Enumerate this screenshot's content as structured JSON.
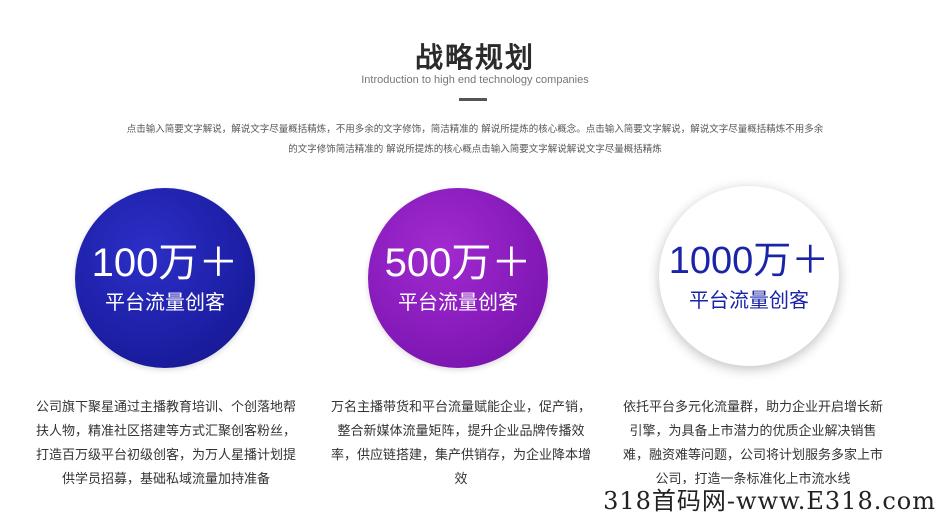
{
  "header": {
    "title": "战略规划",
    "subtitle": "Introduction to high end technology companies",
    "description": "点击输入简要文字解说，解说文字尽量概括精炼，不用多余的文字修饰，简洁精准的 解说所提炼的核心概念。点击输入简要文字解说，解说文字尽量概括精炼不用多余的文字修饰简洁精准的 解说所提炼的核心概点击输入简要文字解说解说文字尽量概括精炼"
  },
  "stats": [
    {
      "value": "100万＋",
      "label": "平台流量创客",
      "text": "公司旗下聚星通过主播教育培训、个创落地帮扶人物，精准社区搭建等方式汇聚创客粉丝，打造百万级平台初级创客，为万人星播计划提供学员招募，基础私域流量加持准备"
    },
    {
      "value": "500万＋",
      "label": "平台流量创客",
      "text": "万名主播带货和平台流量赋能企业，促产销，整合新媒体流量矩阵，提升企业品牌传播效率，供应链搭建，集产供销存，为企业降本增效"
    },
    {
      "value": "1000万＋",
      "label": "平台流量创客",
      "text": "依托平台多元化流量群，助力企业开启增长新引擎，为具备上市潜力的优质企业解决销售难，融资难等问题，公司将计划服务多家上市公司，打造一条标准化上市流水线"
    }
  ],
  "watermark": "318首码网-www.E318.com",
  "colors": {
    "circle1": "#1a1c9e",
    "circle2": "#7f17b4",
    "circle3_text": "#1b24a8"
  }
}
